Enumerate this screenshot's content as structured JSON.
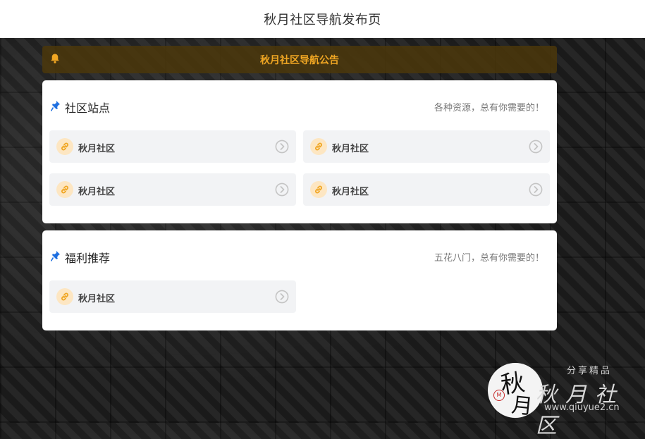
{
  "header": {
    "title": "秋月社区导航发布页"
  },
  "notice": {
    "text": "秋月社区导航公告",
    "icon": "bell-icon",
    "accent": "#f0a623"
  },
  "sections": {
    "sites": {
      "title": "社区站点",
      "subtitle": "各种资源，总有你需要的！",
      "links": [
        "秋月社区",
        "秋月社区",
        "秋月社区",
        "秋月社区"
      ]
    },
    "welfare": {
      "title": "福利推荐",
      "subtitle": "五花八门，总有你需要的！",
      "links": [
        "秋月社区"
      ]
    }
  },
  "watermark": {
    "seal_chars": [
      "秋",
      "月"
    ],
    "stamp": "M",
    "tagline": "分享精品",
    "name": "秋月社区",
    "url": "www.qiuyue2.cn"
  },
  "colors": {
    "link_bg": "#f2f3f5",
    "icon_bg": "#fde6c2",
    "icon_fg": "#f0a623",
    "pin": "#1e6fe0"
  }
}
